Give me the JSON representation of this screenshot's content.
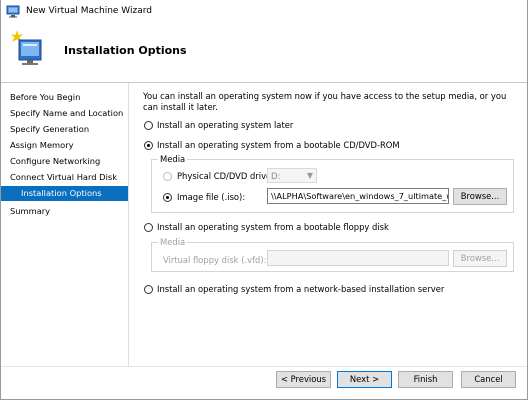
{
  "window": {
    "title": "New Virtual Machine Wizard"
  },
  "header": {
    "title": "Installation Options",
    "icon": "virtual-machine-wizard-icon"
  },
  "sidebar": {
    "items": [
      {
        "label": "Before You Begin",
        "active": false
      },
      {
        "label": "Specify Name and Location",
        "active": false
      },
      {
        "label": "Specify Generation",
        "active": false
      },
      {
        "label": "Assign Memory",
        "active": false
      },
      {
        "label": "Configure Networking",
        "active": false
      },
      {
        "label": "Connect Virtual Hard Disk",
        "active": false
      },
      {
        "label": "Installation Options",
        "active": true
      },
      {
        "label": "Summary",
        "active": false
      }
    ]
  },
  "main": {
    "intro": "You can install an operating system now if you have access to the setup media, or you can install it later.",
    "options": {
      "later": {
        "label": "Install an operating system later",
        "selected": false
      },
      "cd": {
        "label": "Install an operating system from a bootable CD/DVD-ROM",
        "selected": true
      },
      "floppy": {
        "label": "Install an operating system from a bootable floppy disk",
        "selected": false
      },
      "network": {
        "label": "Install an operating system from a network-based installation server",
        "selected": false
      }
    },
    "cd_media": {
      "group_title": "Media",
      "physical_label": "Physical CD/DVD drive:",
      "physical_selected": false,
      "drive_value": "D:",
      "image_label": "Image file (.iso):",
      "image_selected": true,
      "image_path": "\\\\ALPHA\\Software\\en_windows_7_ultimate_with_",
      "browse_label": "Browse..."
    },
    "floppy_media": {
      "group_title": "Media",
      "vfd_label": "Virtual floppy disk (.vfd):",
      "vfd_value": "",
      "browse_label": "Browse..."
    }
  },
  "footer": {
    "previous_label": "< Previous",
    "next_label": "Next >",
    "finish_label": "Finish",
    "cancel_label": "Cancel"
  }
}
